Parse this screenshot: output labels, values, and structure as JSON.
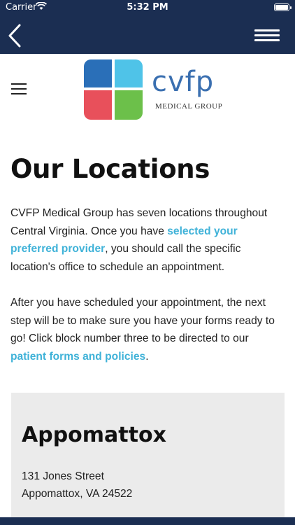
{
  "status_bar": {
    "carrier": "Carrier",
    "time": "5:32 PM"
  },
  "nav": {
    "back_icon": "chevron-left-icon",
    "menu_icon": "hamburger-menu-icon"
  },
  "header": {
    "menu_icon": "hamburger-menu-icon",
    "logo_word": "cvfp",
    "logo_sub": "MEDICAL GROUP",
    "logo_colors": [
      "#2a6fb8",
      "#4fc3e8",
      "#e8505b",
      "#6cc04a"
    ]
  },
  "main": {
    "title": "Our Locations",
    "p1_part1": "CVFP Medical Group has seven locations throughout Central Virginia. Once you have ",
    "p1_link": "selected your preferred provider",
    "p1_part2": ", you should call the specific location's office to schedule an appointment.",
    "p2_part1": "After you have scheduled your appointment, the next step will be to make sure you have your forms ready to go! Click block number three to be directed to our ",
    "p2_link": "patient forms and policies",
    "p2_part2": "."
  },
  "location_card": {
    "name": "Appomattox",
    "street": "131 Jones Street",
    "city": "Appomattox, VA 24522"
  },
  "colors": {
    "nav_bg": "#1b2e52",
    "link": "#3fb2d8",
    "card_bg": "#ebebeb"
  }
}
